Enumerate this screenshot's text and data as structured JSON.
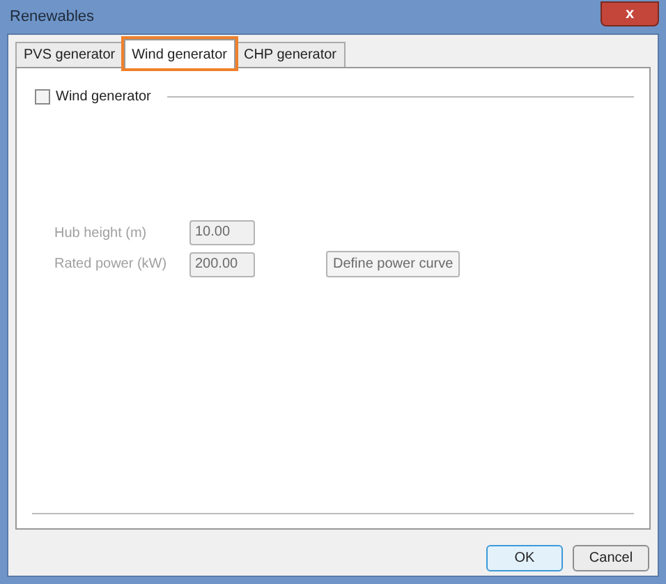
{
  "window": {
    "title": "Renewables",
    "close_label": "x"
  },
  "tabs": [
    {
      "label": "PVS generator",
      "selected": false,
      "highlighted": false
    },
    {
      "label": "Wind generator",
      "selected": true,
      "highlighted": true
    },
    {
      "label": "CHP generator",
      "selected": false,
      "highlighted": false
    }
  ],
  "group": {
    "label": "Wind generator",
    "checked": false
  },
  "fields": [
    {
      "label": "Hub height (m)",
      "value": "10.00",
      "disabled": true
    },
    {
      "label": "Rated power (kW)",
      "value": "200.00",
      "disabled": true
    }
  ],
  "side_button": {
    "label": "Define power curve",
    "disabled": true
  },
  "buttons": [
    {
      "label": "OK",
      "default": true
    },
    {
      "label": "Cancel",
      "default": false
    }
  ]
}
